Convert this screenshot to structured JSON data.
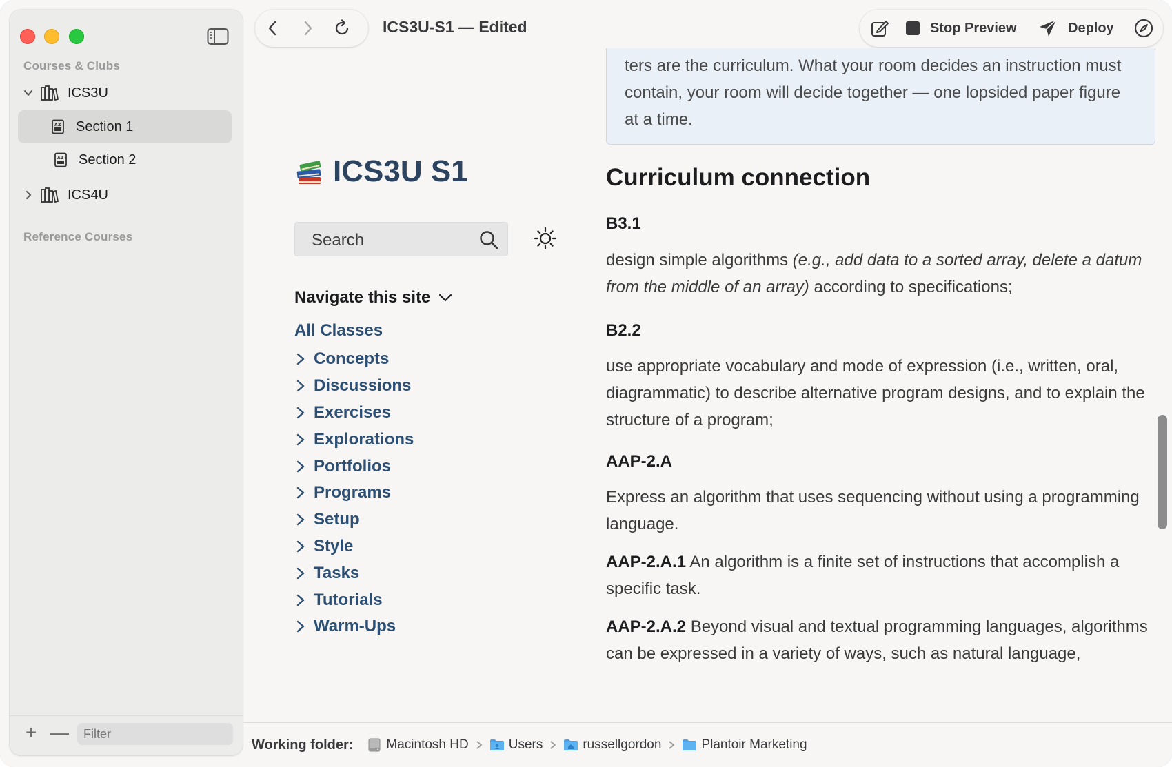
{
  "window": {
    "title": "ICS3U-S1 — Edited"
  },
  "sidebar": {
    "section1_header": "Courses & Clubs",
    "section2_header": "Reference Courses",
    "items": [
      {
        "label": "ICS3U"
      },
      {
        "label": "Section 1"
      },
      {
        "label": "Section 2"
      },
      {
        "label": "ICS4U"
      }
    ],
    "filter_placeholder": "Filter",
    "add_symbol": "+",
    "remove_symbol": "—"
  },
  "toolbar": {
    "stop_preview_label": "Stop Preview",
    "deploy_label": "Deploy"
  },
  "site": {
    "title": "ICS3U S1",
    "search_placeholder": "Search",
    "nav_heading": "Navigate this site",
    "all_classes": "All Classes",
    "nav_items": [
      "Concepts",
      "Discussions",
      "Exercises",
      "Explorations",
      "Portfolios",
      "Programs",
      "Setup",
      "Style",
      "Tasks",
      "Tutorials",
      "Warm-Ups"
    ]
  },
  "article": {
    "callout_text": "ters are the curriculum. What your room decides an instruction must contain, your room will decide together — one lopsided paper figure at a time.",
    "heading": "Curriculum connection",
    "b31_code": "B3.1",
    "b31_pre": "design simple algorithms ",
    "b31_em": "(e.g., add data to a sorted array, delete a datum from the middle of an array)",
    "b31_post": " according to specifications;",
    "b22_code": "B2.2",
    "b22_text": "use appropriate vocabulary and mode of expression (i.e., written, oral, diagrammatic) to describe alternative program designs, and to explain the structure of a program;",
    "aap2a_code": "AAP-2.A",
    "aap2a_text": "Express an algorithm that uses sequencing without using a programming language.",
    "aap2a1_code": "AAP-2.A.1",
    "aap2a1_text": " An algorithm is a finite set of instructions that accomplish a specific task.",
    "aap2a2_code": "AAP-2.A.2",
    "aap2a2_text": " Beyond visual and textual programming languages, algorithms can be expressed in a variety of ways, such as natural language,"
  },
  "statusbar": {
    "label": "Working folder:",
    "path": [
      "Macintosh HD",
      "Users",
      "russellgordon",
      "Plantoir Marketing"
    ]
  },
  "colors": {
    "link": "#2c4f73",
    "title": "#2c4460",
    "callout_bg": "#eaf0f8",
    "folder_blue": "#4aa3e8"
  }
}
